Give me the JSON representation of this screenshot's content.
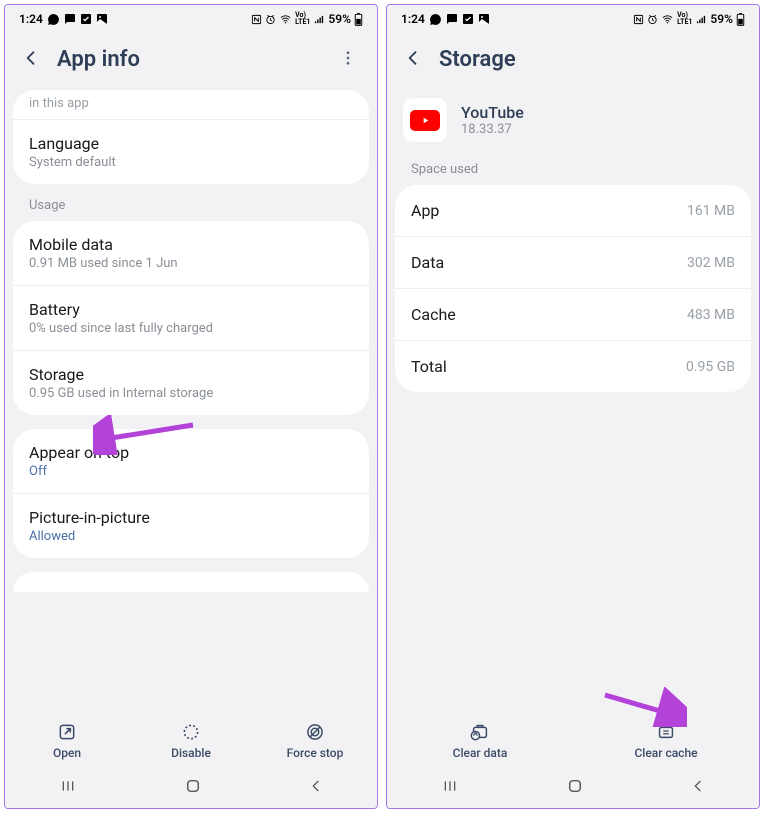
{
  "status": {
    "time": "1:24",
    "battery": "59%"
  },
  "left": {
    "title": "App info",
    "truncated_top": "in this app",
    "language": {
      "title": "Language",
      "sub": "System default"
    },
    "section_usage": "Usage",
    "mobile_data": {
      "title": "Mobile data",
      "sub": "0.91 MB used since 1 Jun"
    },
    "battery": {
      "title": "Battery",
      "sub": "0% used since last fully charged"
    },
    "storage": {
      "title": "Storage",
      "sub": "0.95 GB used in Internal storage"
    },
    "appear_on_top": {
      "title": "Appear on top",
      "sub": "Off"
    },
    "pip": {
      "title": "Picture-in-picture",
      "sub": "Allowed"
    },
    "actions": {
      "open": "Open",
      "disable": "Disable",
      "force_stop": "Force stop"
    }
  },
  "right": {
    "title": "Storage",
    "app": {
      "name": "YouTube",
      "version": "18.33.37"
    },
    "section_space": "Space used",
    "rows": {
      "app": {
        "label": "App",
        "value": "161 MB"
      },
      "data": {
        "label": "Data",
        "value": "302 MB"
      },
      "cache": {
        "label": "Cache",
        "value": "483 MB"
      },
      "total": {
        "label": "Total",
        "value": "0.95 GB"
      }
    },
    "actions": {
      "clear_data": "Clear data",
      "clear_cache": "Clear cache"
    }
  }
}
